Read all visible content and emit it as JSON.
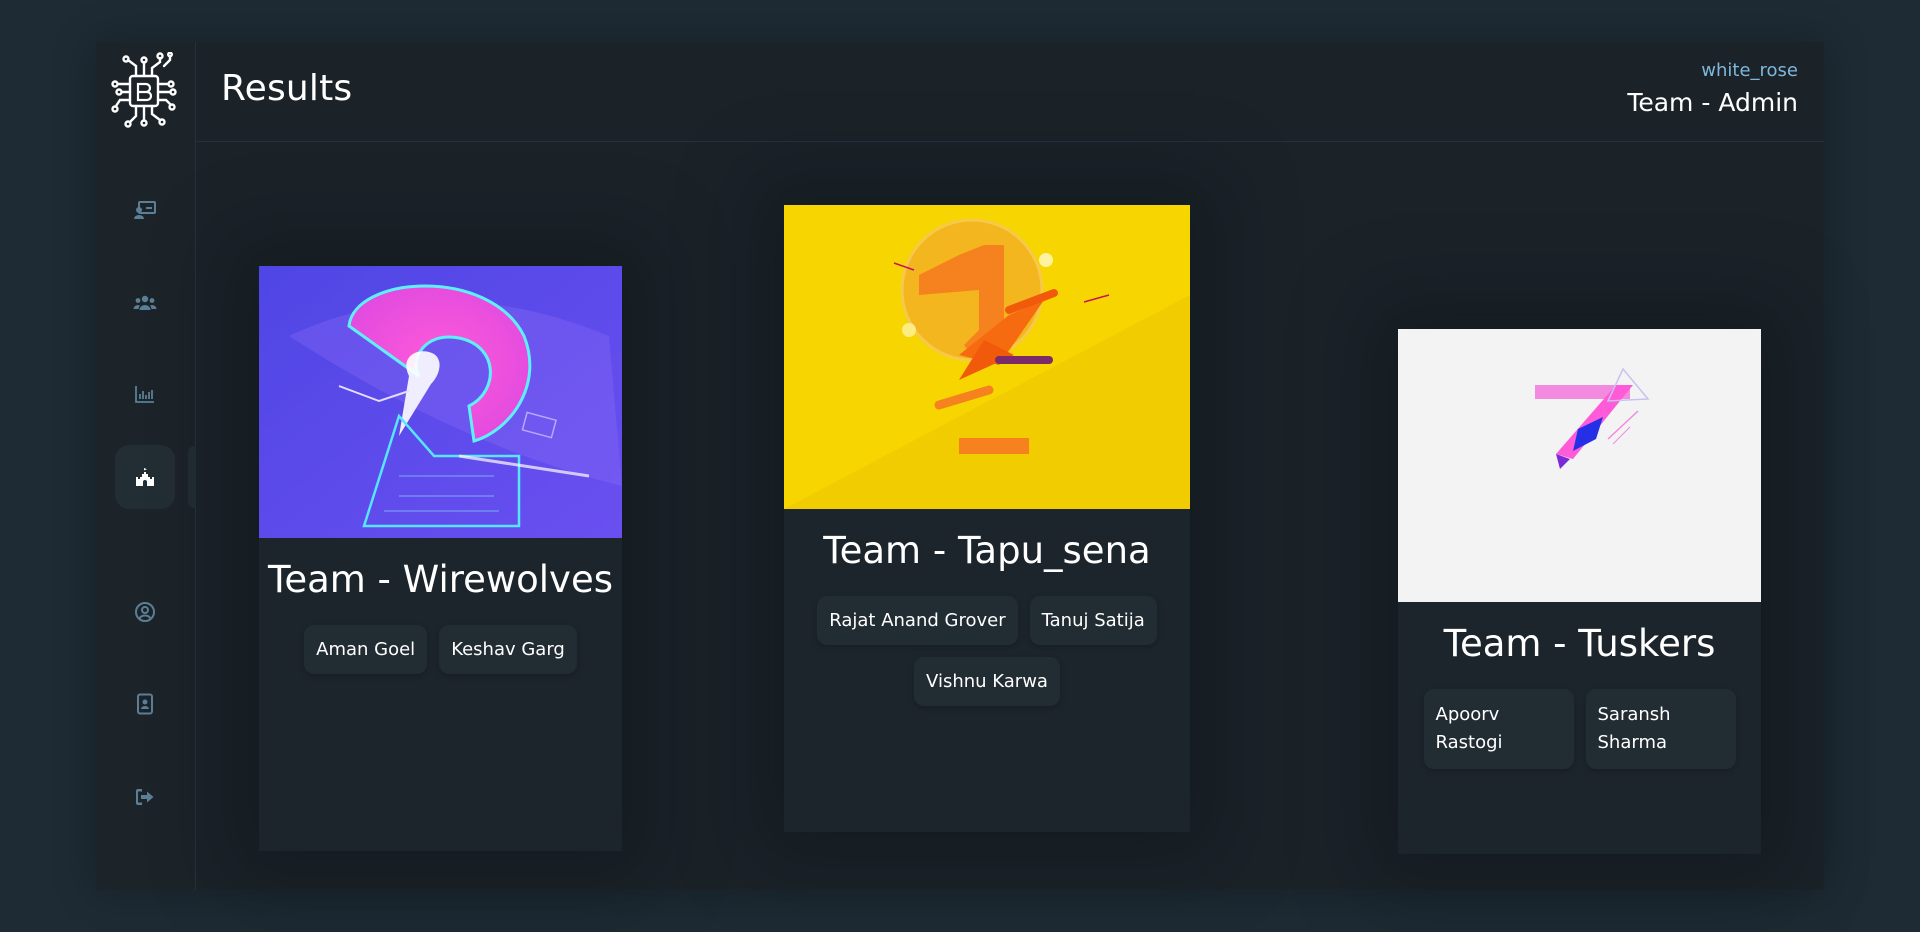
{
  "header": {
    "title": "Results",
    "user_name": "white_rose",
    "user_team": "Team - Admin"
  },
  "sidebar": {
    "items": [
      {
        "icon": "presentation-icon",
        "name": "sidebar-item-presentation"
      },
      {
        "icon": "users-icon",
        "name": "sidebar-item-teams"
      },
      {
        "icon": "bar-chart-icon",
        "name": "sidebar-item-stats"
      },
      {
        "icon": "castle-icon",
        "name": "sidebar-item-results",
        "active": true
      },
      {
        "icon": "user-circle-icon",
        "name": "sidebar-item-profile"
      },
      {
        "icon": "id-card-icon",
        "name": "sidebar-item-contact"
      },
      {
        "icon": "sign-out-icon",
        "name": "sidebar-item-logout"
      }
    ]
  },
  "results": [
    {
      "rank_graphic": "2",
      "team": "Team - Wirewolves",
      "members": [
        "Aman Goel",
        "Keshav Garg"
      ]
    },
    {
      "rank_graphic": "1",
      "team": "Team - Tapu_sena",
      "members": [
        "Rajat Anand Grover",
        "Tanuj Satija",
        "Vishnu Karwa"
      ]
    },
    {
      "rank_graphic": "7",
      "team": "Team - Tuskers",
      "members": [
        "Apoorv Rastogi",
        "Saransh Sharma"
      ]
    }
  ],
  "colors": {
    "background": "#1e2b34",
    "panel": "#1b2329",
    "accent_user": "#7fb7dc",
    "icon": "#5b7f96"
  }
}
